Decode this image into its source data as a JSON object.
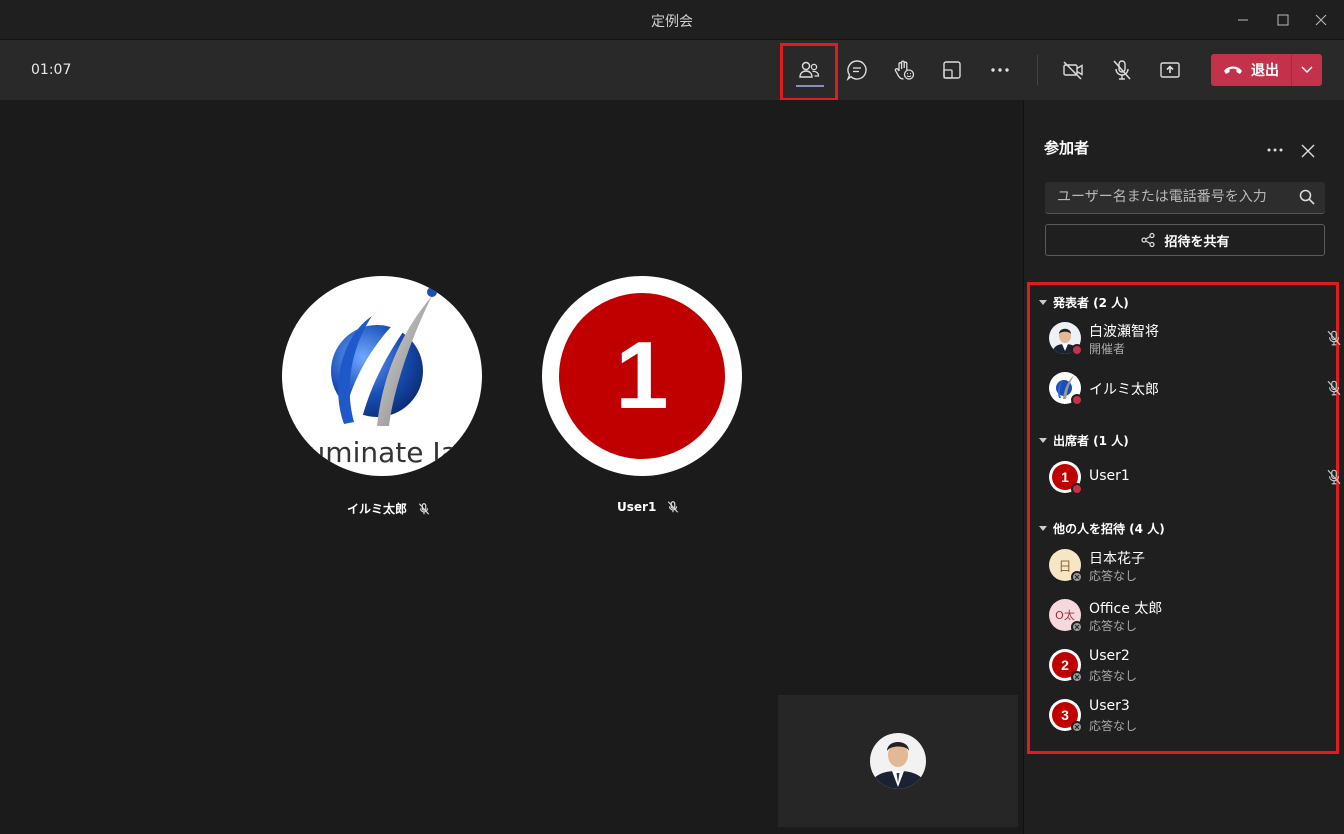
{
  "window": {
    "title": "定例会"
  },
  "toolbar": {
    "timer": "01:07",
    "leave_label": "退出"
  },
  "stage": {
    "tiles": [
      {
        "name": "イルミ太郎",
        "logo_text": "lluminate Japa"
      },
      {
        "name": "User1",
        "avatar_text": "1"
      }
    ]
  },
  "panel": {
    "title": "参加者",
    "search_placeholder": "ユーザー名または電話番号を入力",
    "share_label": "招待を共有",
    "sections": [
      {
        "header": "発表者 (2 人)"
      },
      {
        "header": "出席者 (1 人)"
      },
      {
        "header": "他の人を招待 (4 人)"
      }
    ],
    "people": [
      {
        "name": "白波瀬智将",
        "sub": "開催者"
      },
      {
        "name": "イルミ太郎",
        "sub": ""
      },
      {
        "name": "User1",
        "sub": "",
        "initial": "1"
      },
      {
        "name": "日本花子",
        "sub": "応答なし",
        "initial": "日"
      },
      {
        "name": "Office 太郎",
        "sub": "応答なし",
        "initial": "O太"
      },
      {
        "name": "User2",
        "sub": "応答なし",
        "initial": "2"
      },
      {
        "name": "User3",
        "sub": "応答なし",
        "initial": "3"
      }
    ]
  },
  "colors": {
    "accent": "#8b8cc7",
    "leave": "#c4314b",
    "highlight": "#e01b22",
    "user_red": "#c00000"
  }
}
